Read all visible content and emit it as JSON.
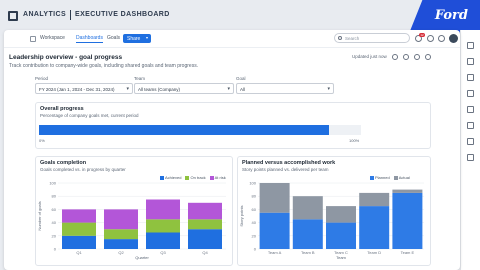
{
  "brand": {
    "title": "ANALYTICS",
    "subtitle": "EXECUTIVE DASHBOARD",
    "logo_text": "Ford"
  },
  "toolbar": {
    "workspace": "Workspace",
    "tabs": [
      {
        "label": "Dashboards",
        "active": true
      },
      {
        "label": "Goals",
        "active": false
      }
    ],
    "share_label": "Share",
    "search_placeholder": "Search",
    "notification_count": "12"
  },
  "header": {
    "title": "Leadership overview - goal progress",
    "subtitle": "Track contribution to company-wide goals, including shared goals and team progress.",
    "last_updated": "Updated just now"
  },
  "filters": [
    {
      "label": "Period",
      "value": "FY 2024 (Jan 1, 2024 - Dec 31, 2024)"
    },
    {
      "label": "Team",
      "value": "All teams (Company)"
    },
    {
      "label": "Goal",
      "value": "All"
    }
  ],
  "overall_progress": {
    "title": "Overall progress",
    "subtitle": "Percentage of company goals met, current period",
    "value_percent": 90,
    "min_label": "0%",
    "max_label": "100%"
  },
  "goals_chart": {
    "title": "Goals completion",
    "subtitle": "Goals completed vs. in progress by quarter",
    "chart_data": {
      "type": "bar",
      "stacked": true,
      "categories": [
        "Q1",
        "Q2",
        "Q3",
        "Q4"
      ],
      "series": [
        {
          "name": "Achieved",
          "color": "#1f6fe0",
          "values": [
            20,
            15,
            25,
            30
          ]
        },
        {
          "name": "On track",
          "color": "#8fc23f",
          "values": [
            20,
            15,
            20,
            15
          ]
        },
        {
          "name": "At risk",
          "color": "#b356d8",
          "values": [
            20,
            30,
            30,
            25
          ]
        }
      ],
      "xlabel": "Quarter",
      "ylabel": "Number of goals",
      "ylim": [
        0,
        100
      ],
      "yticks": [
        0,
        20,
        40,
        60,
        80,
        100
      ],
      "legend": "top-right",
      "grid": true
    }
  },
  "contrib_chart": {
    "title": "Planned versus accomplished work",
    "subtitle": "Story points planned vs. delivered per team",
    "chart_data": {
      "type": "bar",
      "stacked": true,
      "categories": [
        "Team A",
        "Team B",
        "Team C",
        "Team D",
        "Team E"
      ],
      "series": [
        {
          "name": "Planned",
          "color": "#2e7be6",
          "values": [
            55,
            45,
            40,
            65,
            85
          ]
        },
        {
          "name": "Actual",
          "color": "#8e97a3",
          "values": [
            45,
            35,
            25,
            20,
            5
          ]
        }
      ],
      "xlabel": "Team",
      "ylabel": "Story points",
      "ylim": [
        0,
        100
      ],
      "yticks": [
        0,
        20,
        40,
        60,
        80,
        100
      ],
      "legend": "top-right",
      "grid": true
    }
  }
}
